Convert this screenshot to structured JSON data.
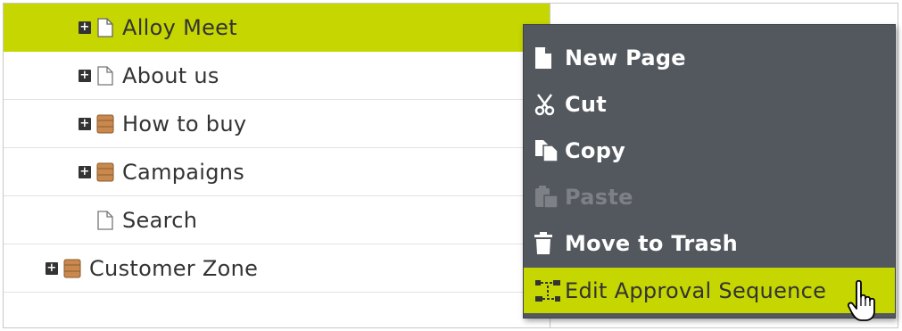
{
  "tree": {
    "items": [
      {
        "label": "Alloy Meet",
        "icon": "page-icon",
        "expandable": true,
        "selected": true
      },
      {
        "label": "About us",
        "icon": "page-icon",
        "expandable": true,
        "selected": false
      },
      {
        "label": "How to buy",
        "icon": "container-icon",
        "expandable": true,
        "selected": false
      },
      {
        "label": "Campaigns",
        "icon": "container-icon",
        "expandable": true,
        "selected": false
      },
      {
        "label": "Search",
        "icon": "page-icon",
        "expandable": false,
        "selected": false
      },
      {
        "label": "Customer Zone",
        "icon": "container-icon",
        "expandable": true,
        "selected": false
      }
    ]
  },
  "context_menu": {
    "items": [
      {
        "label": "New Page",
        "icon": "new-page-icon",
        "enabled": true
      },
      {
        "label": "Cut",
        "icon": "scissors-icon",
        "enabled": true
      },
      {
        "label": "Copy",
        "icon": "copy-icon",
        "enabled": true
      },
      {
        "label": "Paste",
        "icon": "paste-icon",
        "enabled": false
      },
      {
        "label": "Move to Trash",
        "icon": "trash-icon",
        "enabled": true
      },
      {
        "label": "Edit Approval Sequence",
        "icon": "approval-sequence-icon",
        "enabled": true,
        "highlighted": true
      }
    ]
  },
  "colors": {
    "selection": "#c6d600",
    "menu_background": "#53585e"
  },
  "cursor": "hand-pointer-icon"
}
